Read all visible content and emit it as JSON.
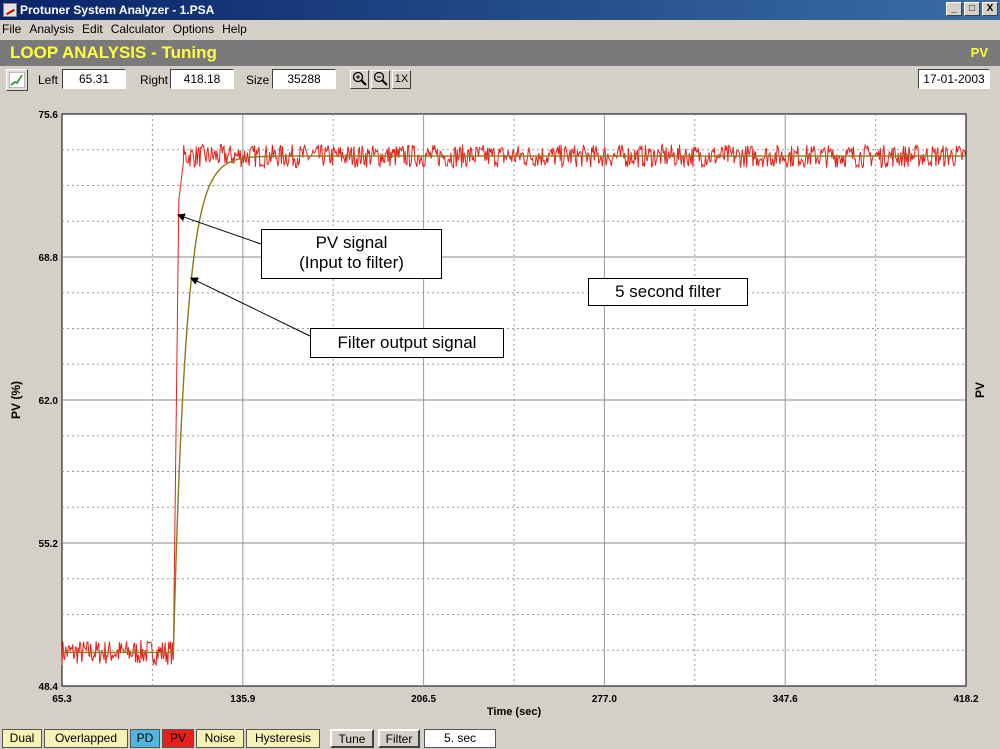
{
  "window": {
    "title": "Protuner System Analyzer - 1.PSA",
    "controls": [
      "_",
      "□",
      "X"
    ]
  },
  "menu": [
    "File",
    "Analysis",
    "Edit",
    "Calculator",
    "Options",
    "Help"
  ],
  "banner": {
    "title": "LOOP ANALYSIS - Tuning",
    "right": "PV",
    "text_color": "#ffff3b",
    "bg_color": "#7a7a7a"
  },
  "toolbar": {
    "left_label": "Left",
    "left_value": "65.31",
    "right_label": "Right",
    "right_value": "418.18",
    "size_label": "Size",
    "size_value": "35288",
    "zoom_in_icon": "zoom-in-icon",
    "zoom_out_icon": "zoom-out-icon",
    "zoom_reset": "1X",
    "date": "17-01-2003"
  },
  "annotations": {
    "pv_signal_line1": "PV signal",
    "pv_signal_line2": "(Input to filter)",
    "filter_output": "Filter output signal",
    "filter_note": "5 second filter"
  },
  "tabs": [
    "Dual",
    "Overlapped",
    "PD",
    "PV",
    "Noise",
    "Hysteresis",
    "Tune",
    "Filter"
  ],
  "filter_value": "5. sec",
  "chart_data": {
    "type": "line",
    "xlabel": "Time (sec)",
    "ylabel": "PV (%)",
    "right_axis_label": "PV",
    "xlim": [
      65.3,
      418.2
    ],
    "ylim": [
      48.4,
      75.6
    ],
    "x_ticks": [
      "65.3",
      "135.9",
      "206.5",
      "277.0",
      "347.6",
      "418.2"
    ],
    "y_ticks": [
      "48.4",
      "55.2",
      "62.0",
      "68.8",
      "75.6"
    ],
    "grid": true,
    "series": [
      {
        "color": "#e8201a",
        "segments": [
          {
            "x_from": 65.3,
            "x_to": 108.8,
            "value": 50.0,
            "noise": 0.6
          },
          {
            "x_from": 108.8,
            "x_to": 110.9,
            "value_from": 50.0,
            "value_to": 71.5
          },
          {
            "x_from": 110.9,
            "x_to": 112.8,
            "value_from": 71.5,
            "value_to": 73.4
          },
          {
            "x_from": 112.8,
            "x_to": 418.2,
            "value": 73.6,
            "noise": 0.55
          }
        ]
      },
      {
        "color": "#8a7a1a",
        "segments": [
          {
            "x_from": 65.3,
            "x_to": 108.8,
            "value": 50.0
          },
          {
            "x_from": 108.8,
            "x_to": 418.2,
            "first_order_step_to": 73.6,
            "time_constant": 5
          }
        ]
      }
    ]
  }
}
